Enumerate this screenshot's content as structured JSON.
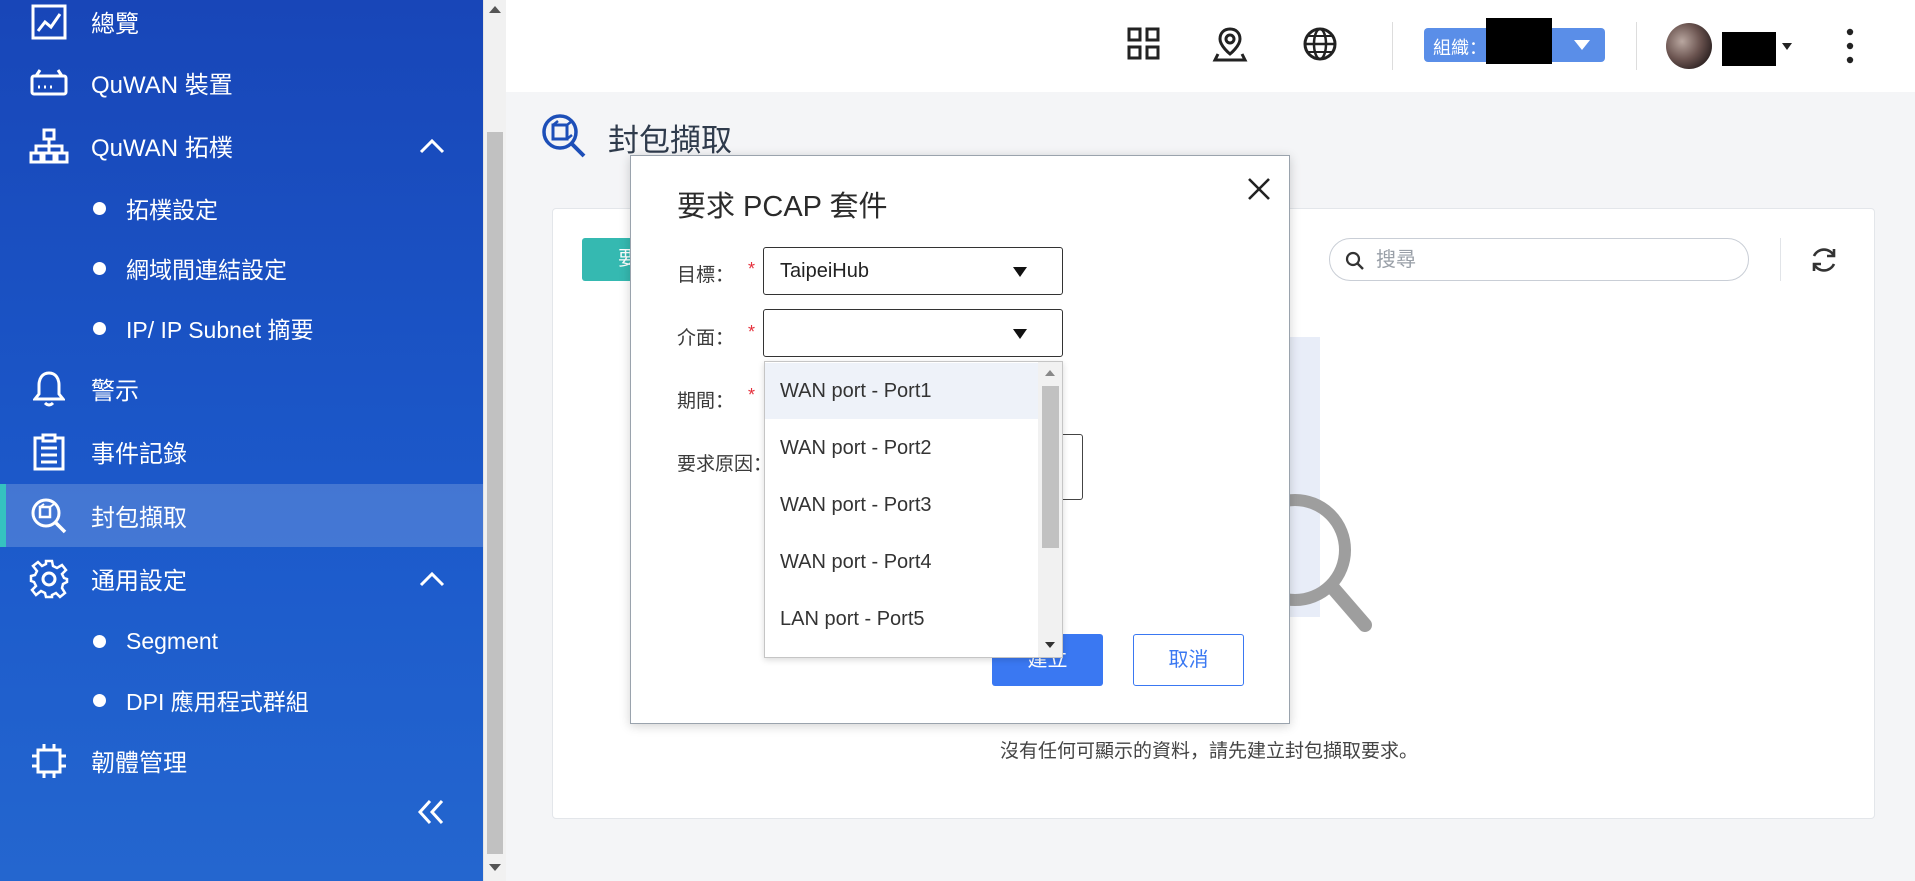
{
  "sidebar": {
    "items": [
      {
        "label": "總覽",
        "icon": "chart-line-icon"
      },
      {
        "label": "QuWAN 裝置",
        "icon": "device-icon"
      },
      {
        "label": "QuWAN 拓樸",
        "icon": "topology-icon"
      },
      {
        "label": "拓樸設定"
      },
      {
        "label": "網域間連結設定"
      },
      {
        "label": "IP/ IP Subnet 摘要"
      },
      {
        "label": "警示",
        "icon": "bell-icon"
      },
      {
        "label": "事件記錄",
        "icon": "clipboard-icon"
      },
      {
        "label": "封包擷取",
        "icon": "packet-capture-icon"
      },
      {
        "label": "通用設定",
        "icon": "gear-icon"
      },
      {
        "label": "Segment"
      },
      {
        "label": "DPI 應用程式群組"
      },
      {
        "label": "韌體管理",
        "icon": "chip-icon"
      }
    ],
    "active_color": "#35c2c0"
  },
  "header": {
    "org_label": "組織："
  },
  "page": {
    "title": "封包擷取",
    "request_button_label": "要",
    "search_placeholder": "搜尋",
    "empty_message": "沒有任何可顯示的資料，請先建立封包擷取要求。"
  },
  "modal": {
    "title": "要求 PCAP 套件",
    "required_mark": "*",
    "fields": {
      "target_label": "目標：",
      "target_value": "TaipeiHub",
      "interface_label": "介面：",
      "interface_value": "",
      "period_label": "期間：",
      "reason_label": "要求原因："
    },
    "create_label": "建立",
    "cancel_label": "取消",
    "dropdown_options": [
      "WAN port - Port1",
      "WAN port - Port2",
      "WAN port - Port3",
      "WAN port - Port4",
      "LAN port - Port5"
    ]
  },
  "colors": {
    "sidebar": "#1c5acb",
    "primary": "#3a78f2",
    "accent": "#35b9b1",
    "required": "#e5303c"
  }
}
